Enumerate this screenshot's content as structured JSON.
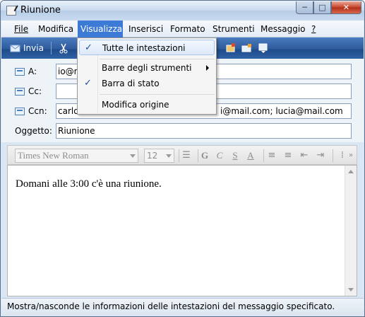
{
  "window": {
    "title": "Riunione",
    "controls": {
      "minimize": "─",
      "maximize": "□",
      "close": "✕"
    }
  },
  "menubar": {
    "items": [
      {
        "label": "File"
      },
      {
        "label": "Modifica"
      },
      {
        "label": "Visualizza"
      },
      {
        "label": "Inserisci"
      },
      {
        "label": "Formato"
      },
      {
        "label": "Strumenti"
      },
      {
        "label": "Messaggio"
      },
      {
        "label": "?"
      }
    ]
  },
  "toolbar": {
    "send_label": "Invia"
  },
  "view_menu": {
    "items": [
      {
        "label": "Tutte le intestazioni",
        "checked": true
      },
      {
        "label": "Barre degli strumenti",
        "submenu": true
      },
      {
        "label": "Barra di stato",
        "checked": true
      },
      {
        "label": "Modifica origine"
      }
    ]
  },
  "headers": {
    "to": {
      "label": "A:",
      "value": "io@m"
    },
    "cc": {
      "label": "Cc:",
      "value": ""
    },
    "bcc": {
      "label": "Ccn:",
      "value": "carlo",
      "value_tail": "i@mail.com; lucia@mail.com"
    },
    "subject": {
      "label": "Oggetto:",
      "value": "Riunione"
    }
  },
  "format": {
    "font": "Times New Roman",
    "size": "12"
  },
  "body": {
    "text": "Domani alle 3:00 c'è una riunione."
  },
  "status": {
    "text": "Mostra/nasconde le informazioni delle intestazioni del messaggio specificato."
  }
}
